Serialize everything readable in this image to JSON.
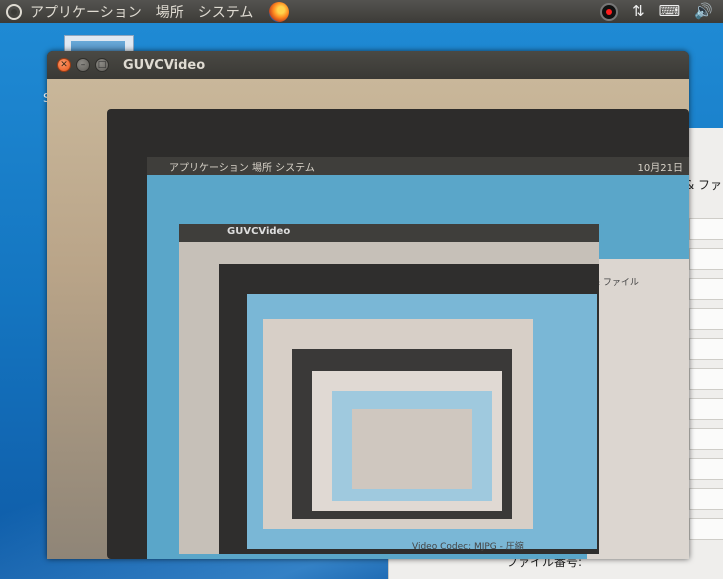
{
  "top_panel": {
    "menus": [
      "アプリケーション",
      "場所",
      "システム"
    ],
    "indicators": [
      "record-indicator",
      "network-icon",
      "keyboard-icon",
      "volume-icon"
    ]
  },
  "desktop": {
    "icon_label": "S"
  },
  "background_window": {
    "tab_text": "& ファ",
    "bottom_text": "ファイル番号:"
  },
  "video_window": {
    "title": "GUVCVideo",
    "buttons": [
      "close",
      "minimize",
      "maximize"
    ]
  },
  "video_content": {
    "panel_menus": "アプリケーション 場所 システム",
    "panel_clock": "10月21日",
    "inner_window_title": "GUVCVideo",
    "inner_tab": "& ファイル",
    "inner_codec": "Video Codec: MJPG - 圧縮"
  },
  "colors": {
    "panel": "#3c3b37",
    "desktop": "#1475c0",
    "close_button": "#e5551b"
  }
}
